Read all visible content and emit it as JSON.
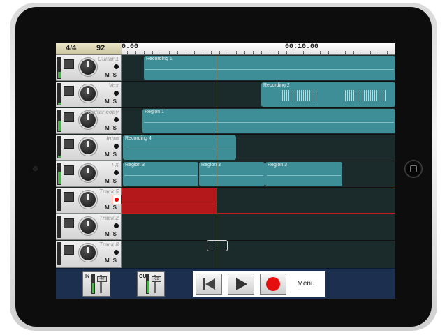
{
  "header": {
    "time_signature": "4/4",
    "tempo": "92",
    "ruler_labels": [
      "0.00",
      "00:10.00"
    ]
  },
  "tracks": [
    {
      "name": "Guitar 1",
      "meter_level": 0.3,
      "armed": false
    },
    {
      "name": "Vox",
      "meter_level": 0.1,
      "armed": false
    },
    {
      "name": "Guitar copy",
      "meter_level": 0.5,
      "armed": false
    },
    {
      "name": "Intro",
      "meter_level": 0.1,
      "armed": false
    },
    {
      "name": "FX",
      "meter_level": 0.6,
      "armed": false
    },
    {
      "name": "Track 5",
      "meter_level": 0.0,
      "armed": true
    },
    {
      "name": "Track 2",
      "meter_level": 0.0,
      "armed": false
    },
    {
      "name": "Track 8",
      "meter_level": 0.0,
      "armed": false
    }
  ],
  "mute_solo_label": "MS",
  "regions": {
    "r0": "Recording 1",
    "r1": "Recording 2",
    "r2": "Region 1",
    "r3": "Recording 4",
    "r4a": "Region 3",
    "r4b": "Region 3",
    "r4c": "Region 3"
  },
  "bottom_bar": {
    "in_label": "IN",
    "out_label": "OUT",
    "in_level": "-47",
    "out_level": "-28",
    "menu_label": "Menu"
  },
  "colors": {
    "region": "#3e8e97",
    "recording_region": "#b5181a",
    "bottom_bar": "#1c2f4e",
    "lane_background": "#1b2a2a"
  },
  "icons": [
    "rewind-to-start-icon",
    "play-icon",
    "record-icon"
  ]
}
